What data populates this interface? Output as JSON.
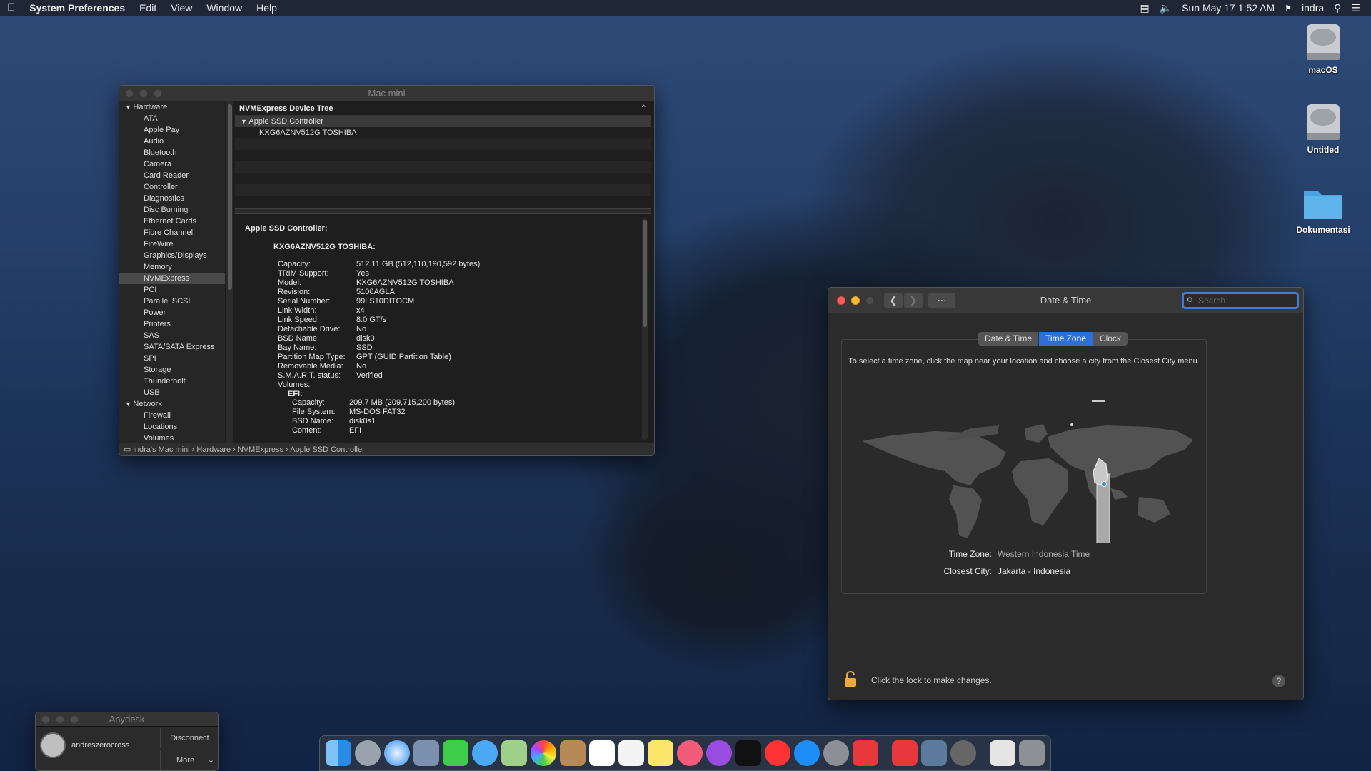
{
  "menubar": {
    "app": "System Preferences",
    "items": [
      "Edit",
      "View",
      "Window",
      "Help"
    ],
    "clock": "Sun May 17  1:52 AM",
    "user": "indra"
  },
  "desktop": {
    "icons": [
      "macOS",
      "Untitled",
      "Dokumentasi"
    ]
  },
  "sysinfo": {
    "title": "Mac mini",
    "sidebar": [
      {
        "label": "Hardware",
        "group": true
      },
      {
        "label": "ATA"
      },
      {
        "label": "Apple Pay"
      },
      {
        "label": "Audio"
      },
      {
        "label": "Bluetooth"
      },
      {
        "label": "Camera"
      },
      {
        "label": "Card Reader"
      },
      {
        "label": "Controller"
      },
      {
        "label": "Diagnostics"
      },
      {
        "label": "Disc Burning"
      },
      {
        "label": "Ethernet Cards"
      },
      {
        "label": "Fibre Channel"
      },
      {
        "label": "FireWire"
      },
      {
        "label": "Graphics/Displays"
      },
      {
        "label": "Memory"
      },
      {
        "label": "NVMExpress",
        "selected": true
      },
      {
        "label": "PCI"
      },
      {
        "label": "Parallel SCSI"
      },
      {
        "label": "Power"
      },
      {
        "label": "Printers"
      },
      {
        "label": "SAS"
      },
      {
        "label": "SATA/SATA Express"
      },
      {
        "label": "SPI"
      },
      {
        "label": "Storage"
      },
      {
        "label": "Thunderbolt"
      },
      {
        "label": "USB"
      },
      {
        "label": "Network",
        "group": true
      },
      {
        "label": "Firewall"
      },
      {
        "label": "Locations"
      },
      {
        "label": "Volumes"
      }
    ],
    "tree_header": "NVMExpress Device Tree",
    "tree_rows": [
      "Apple SSD Controller",
      "KXG6AZNV512G TOSHIBA"
    ],
    "detail_heading": "Apple SSD Controller:",
    "device_name": "KXG6AZNV512G TOSHIBA:",
    "properties": [
      {
        "k": "Capacity:",
        "v": "512.11 GB (512,110,190,592 bytes)"
      },
      {
        "k": "TRIM Support:",
        "v": "Yes"
      },
      {
        "k": "Model:",
        "v": "KXG6AZNV512G TOSHIBA"
      },
      {
        "k": "Revision:",
        "v": "5106AGLA"
      },
      {
        "k": "Serial Number:",
        "v": "99LS10DITOCM"
      },
      {
        "k": "Link Width:",
        "v": "x4"
      },
      {
        "k": "Link Speed:",
        "v": "8.0 GT/s"
      },
      {
        "k": "Detachable Drive:",
        "v": "No"
      },
      {
        "k": "BSD Name:",
        "v": "disk0"
      },
      {
        "k": "Bay Name:",
        "v": "SSD"
      },
      {
        "k": "Partition Map Type:",
        "v": "GPT (GUID Partition Table)"
      },
      {
        "k": "Removable Media:",
        "v": "No"
      },
      {
        "k": "S.M.A.R.T. status:",
        "v": "Verified"
      },
      {
        "k": "Volumes:",
        "v": ""
      }
    ],
    "volume_name": "EFI:",
    "volume_props": [
      {
        "k": "Capacity:",
        "v": "209.7 MB (209,715,200 bytes)"
      },
      {
        "k": "File System:",
        "v": "MS-DOS FAT32"
      },
      {
        "k": "BSD Name:",
        "v": "disk0s1"
      },
      {
        "k": "Content:",
        "v": "EFI"
      }
    ],
    "pathbar": [
      "indra's Mac mini",
      "Hardware",
      "NVMExpress",
      "Apple SSD Controller"
    ]
  },
  "datetime": {
    "title": "Date & Time",
    "search_placeholder": "Search",
    "tabs": [
      {
        "label": "Date & Time"
      },
      {
        "label": "Time Zone",
        "active": true
      },
      {
        "label": "Clock"
      }
    ],
    "instruction": "To select a time zone, click the map near your location and choose a city from the Closest City menu.",
    "tz_label": "Time Zone:",
    "tz_value": "Western Indonesia Time",
    "city_label": "Closest City:",
    "city_value": "Jakarta - Indonesia",
    "lock_text": "Click the lock to make changes.",
    "help": "?"
  },
  "anydesk": {
    "title": "Anydesk",
    "user": "andreszerocross",
    "disconnect": "Disconnect",
    "more": "More"
  }
}
